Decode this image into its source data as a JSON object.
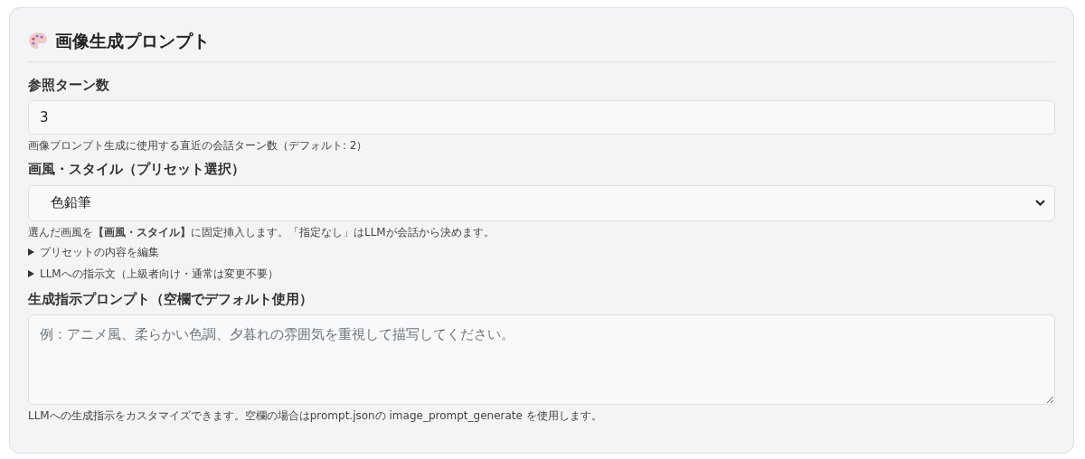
{
  "section": {
    "title": "画像生成プロンプト"
  },
  "fields": [
    {
      "kind": "input",
      "label": "参照ターン数",
      "value": "3",
      "hint": "画像プロンプト生成に使用する直近の会話ターン数（デフォルト: 2）"
    },
    {
      "kind": "select",
      "label": "画風・スタイル（プリセット選択）",
      "value": "色鉛筆",
      "hint": "選んだ画風を**【画風・スタイル】**に固定挿入します。「指定なし」はLLMが会話から決めます。"
    },
    {
      "kind": "disclosure",
      "label": "プリセットの内容を編集",
      "expanded": false
    },
    {
      "kind": "disclosure",
      "label": "LLMへの指示文（上級者向け・通常は変更不要）",
      "expanded": false
    },
    {
      "kind": "textarea",
      "label": "生成指示プロンプト（空欄でデフォルト使用）",
      "placeholder": "例：アニメ風、柔らかい色調、夕暮れの雰囲気を重視して描写してください。",
      "hint": "LLMへの生成指示をカスタマイズできます。空欄の場合はprompt.jsonの image_prompt_generate を使用します。"
    }
  ]
}
